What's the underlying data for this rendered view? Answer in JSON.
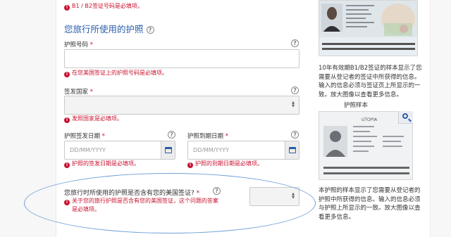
{
  "errors": {
    "top": "B1 / B2签证号码是必填项。",
    "passport_number": "在您美国签证上的护照号码是必填项。",
    "issuing_country": "发照国家是必填项。",
    "issue_date": "护照的签发日期是必填项。",
    "expiry_date": "护照的到期日期是必填项。",
    "question_line1": "关于您的旅行护照是否含有您的美国签证，这个问题的答案",
    "question_line2": "是必填项。"
  },
  "section": {
    "title": "您旅行所使用的护照",
    "help_glyph": "?"
  },
  "fields": {
    "passport_number": {
      "label": "护照号码",
      "required_mark": "*",
      "value": ""
    },
    "issuing_country": {
      "label": "签发国家",
      "required_mark": "*",
      "selected": ""
    },
    "issue_date": {
      "label": "护照签发日期",
      "required_mark": "*",
      "placeholder": "DD/MM/YYYY"
    },
    "expiry_date": {
      "label": "护照到期日期",
      "required_mark": "*",
      "placeholder": "DD/MM/YYYY"
    },
    "visa_in_passport": {
      "label": "您旅行时所使用的护照是否含有您的美国签证?",
      "required_mark": "*",
      "selected": ""
    }
  },
  "sidebar": {
    "visa_caption": [
      "10年有效期B1/B2签证的样本显示了您",
      "需要从登记者的签证中所获得的信息。",
      "输入的信息必须与签证页上所显示的一",
      "致。放大图像以查看更多信息。"
    ],
    "passport_title": "护照样本",
    "passport_caption": [
      "本护照的样本显示了您需要从登记者的",
      "护照中所获得的信息。输入的信息必须",
      "与护照上所显示的一致。放大图像以查",
      "看更多信息。"
    ],
    "passport_sample_country": "UTOPIA"
  },
  "colors": {
    "error": "#c8102e",
    "heading": "#2b5da8",
    "annotation": "#6f9fd8"
  },
  "icons": {
    "help": "help-circle-icon",
    "error": "error-circle-icon",
    "calendar": "calendar-icon",
    "zoom": "magnifier-icon",
    "select": "chevron-updown-icon"
  }
}
